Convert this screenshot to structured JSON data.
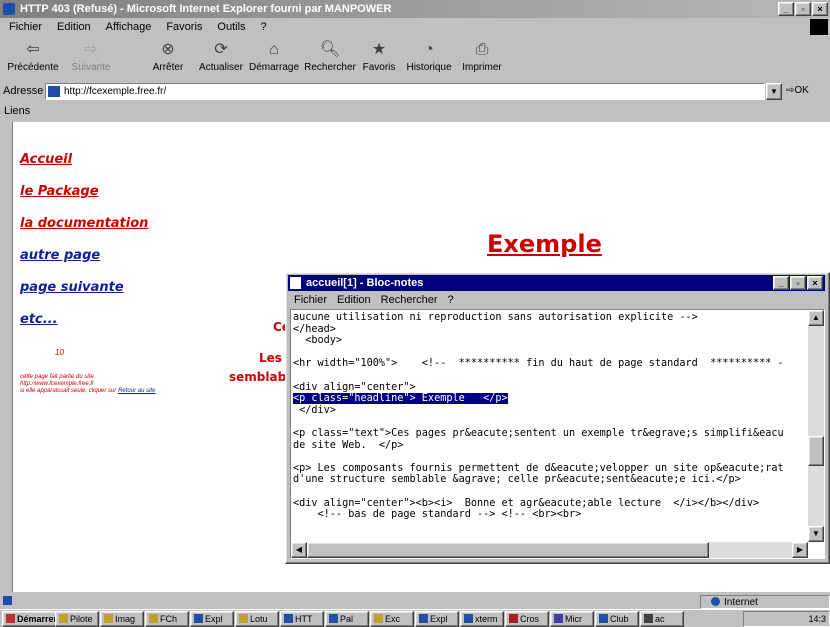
{
  "browser": {
    "title": "HTTP 403 (Refusé) - Microsoft Internet Explorer fourni par MANPOWER",
    "menu": [
      "Fichier",
      "Edition",
      "Affichage",
      "Favoris",
      "Outils",
      "?"
    ],
    "toolbar": [
      {
        "label": "Précédente",
        "icon": "back-arrow-icon"
      },
      {
        "label": "Suivante",
        "icon": "forward-arrow-icon"
      },
      {
        "label": "Arrêter",
        "icon": "stop-icon"
      },
      {
        "label": "Actualiser",
        "icon": "refresh-icon"
      },
      {
        "label": "Démarrage",
        "icon": "home-icon"
      },
      {
        "label": "Rechercher",
        "icon": "search-icon"
      },
      {
        "label": "Favoris",
        "icon": "favorites-icon"
      },
      {
        "label": "Historique",
        "icon": "history-icon"
      },
      {
        "label": "Imprimer",
        "icon": "print-icon"
      }
    ],
    "address_label": "Adresse",
    "address_value": "http://fcexemple.free.fr/",
    "go_label": "OK",
    "links_label": "Liens",
    "status_text": "",
    "status_zone": "Internet"
  },
  "page": {
    "nav": [
      "Accueil",
      "le Package",
      "la documentation",
      "autre page",
      "page suivante",
      "etc..."
    ],
    "heading": "Exemple",
    "counter": "10",
    "small_text": [
      "cette page fait partie du site",
      "http://www.fcexemple.free.fr",
      "si elle apparaissait seule, cliquer sur"
    ],
    "small_link": "Retour au site",
    "fragment_1": "Ce",
    "fragment_2": "Les",
    "fragment_3": "semblable"
  },
  "notepad": {
    "title": "accueil[1] - Bloc-notes",
    "menu": [
      "Fichier",
      "Edition",
      "Rechercher",
      "?"
    ],
    "lines": [
      "aucune utilisation ni reproduction sans autorisation explicite -->",
      "</head>",
      "  <body>",
      "",
      "<hr width=\"100%\">    <!--  ********** fin du haut de page standard  ********** -",
      "",
      "<div align=\"center\">",
      "<p class=\"headline\"> Exemple   </p>",
      " </div>",
      "",
      "<p class=\"text\">Ces pages pr&eacute;sentent un exemple tr&egrave;s simplifi&eacu",
      "de site Web.  </p>",
      "",
      "<p> Les composants fournis permettent de d&eacute;velopper un site op&eacute;rat",
      "d'une structure semblable &agrave; celle pr&eacute;sent&eacute;e ici.</p>",
      "",
      "<div align=\"center\"><b><i>  Bonne et agr&eacute;able lecture  </i></b></div>",
      "    <!-- bas de page standard --> <!-- <br><br>"
    ],
    "selected_line_index": 7
  },
  "taskbar": {
    "start": "Démarrer",
    "tasks": [
      "Pilote",
      "Imag",
      "FCh",
      "Expl",
      "Lotu",
      "HTT",
      "Pal",
      "Exc",
      "Expl",
      "xterm",
      "Cros",
      "Micr",
      "Club",
      "ac"
    ],
    "clock": "14:3"
  }
}
